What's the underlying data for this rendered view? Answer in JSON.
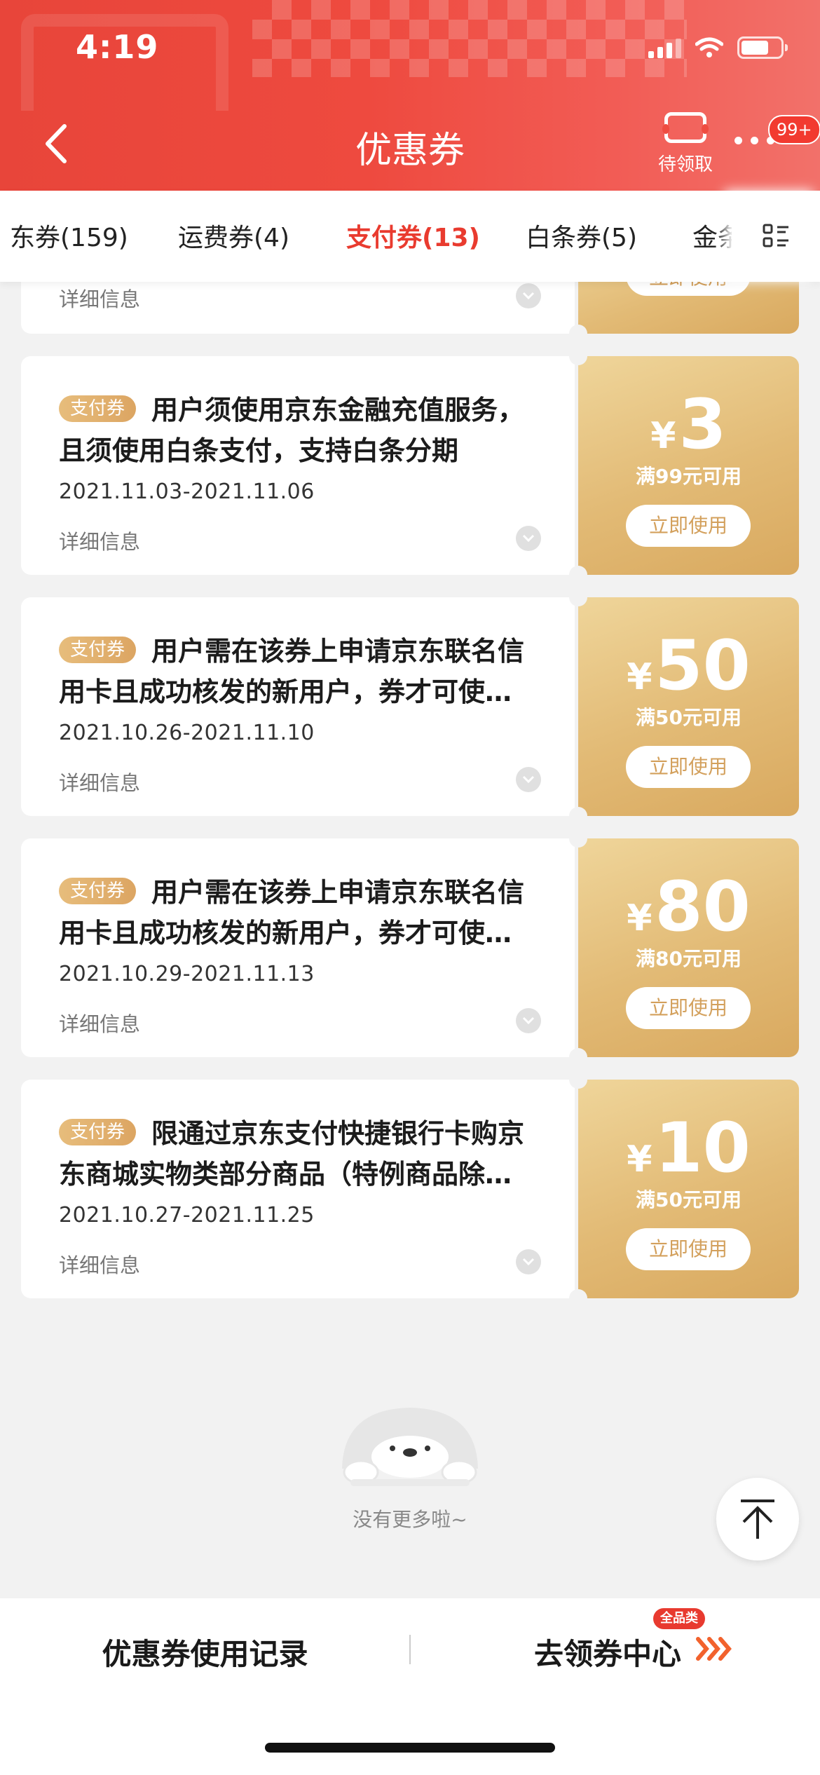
{
  "status": {
    "time": "4:19"
  },
  "header": {
    "title": "优惠券",
    "pending_label": "待领取",
    "more_badge": "99+"
  },
  "tabs": [
    {
      "label": "东券(159)",
      "active": false
    },
    {
      "label": "运费券(4)",
      "active": false
    },
    {
      "label": "支付券(13)",
      "active": true
    },
    {
      "label": "白条券(5)",
      "active": false
    },
    {
      "label": "金条",
      "active": false
    }
  ],
  "partial_coupon": {
    "detail_label": "详细信息",
    "use_label": "立即使用"
  },
  "coupons": [
    {
      "tag": "支付券",
      "description": "用户须使用京东金融充值服务，且须使用白条支付，支持白条分期",
      "date": "2021.11.03-2021.11.06",
      "detail_label": "详细信息",
      "currency": "¥",
      "amount": "3",
      "condition": "满99元可用",
      "use_label": "立即使用"
    },
    {
      "tag": "支付券",
      "description": "用户需在该券上申请京东联名信用卡且成功核发的新用户，券才可使…",
      "date": "2021.10.26-2021.11.10",
      "detail_label": "详细信息",
      "currency": "¥",
      "amount": "50",
      "condition": "满50元可用",
      "use_label": "立即使用"
    },
    {
      "tag": "支付券",
      "description": "用户需在该券上申请京东联名信用卡且成功核发的新用户，券才可使…",
      "date": "2021.10.29-2021.11.13",
      "detail_label": "详细信息",
      "currency": "¥",
      "amount": "80",
      "condition": "满80元可用",
      "use_label": "立即使用"
    },
    {
      "tag": "支付券",
      "description": "限通过京东支付快捷银行卡购京东商城实物类部分商品（特例商品除…",
      "date": "2021.10.27-2021.11.25",
      "detail_label": "详细信息",
      "currency": "¥",
      "amount": "10",
      "condition": "满50元可用",
      "use_label": "立即使用"
    }
  ],
  "end_text": "没有更多啦~",
  "footer": {
    "records_label": "优惠券使用记录",
    "center_label": "去领券中心",
    "center_badge": "全品类"
  },
  "colors": {
    "brand_red": "#e93b2f",
    "coupon_gold": "#e2ba75",
    "page_bg": "#f2f2f2"
  }
}
